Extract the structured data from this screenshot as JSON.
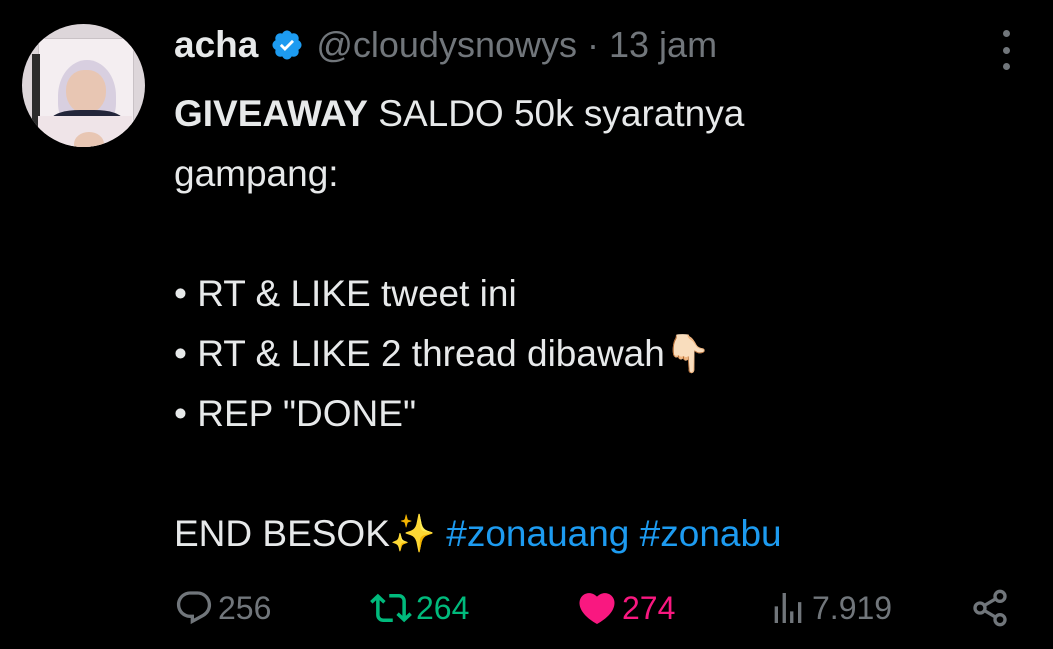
{
  "tweet": {
    "author": {
      "name": "acha",
      "handle": "@cloudysnowys",
      "separator": "·",
      "time": "13 jam",
      "verified": true
    },
    "body": {
      "line1_bold": "GIVEAWAY",
      "line1_rest": " SALDO 50k syaratnya",
      "line2": "gampang:",
      "bullet1": "• RT & LIKE tweet ini",
      "bullet2": "• RT & LIKE 2 thread dibawah",
      "bullet2_emoji": "👇🏻",
      "bullet3": "• REP \"DONE\"",
      "end_text": "END BESOK",
      "end_emoji": "✨",
      "hashtag1": "#zonauang",
      "hashtag2": "#zonabu"
    },
    "actions": {
      "replies": "256",
      "retweets": "264",
      "likes": "274",
      "views": "7.919"
    }
  },
  "icons": {
    "verified": "verified-badge-icon",
    "more": "more-options-icon",
    "reply": "reply-icon",
    "retweet": "retweet-icon",
    "like": "heart-icon",
    "views": "views-icon",
    "share": "share-icon"
  },
  "colors": {
    "background": "#000000",
    "text": "#e7e9ea",
    "muted": "#71767b",
    "link": "#1d9bf0",
    "retweet": "#00ba7c",
    "like": "#f91880"
  }
}
